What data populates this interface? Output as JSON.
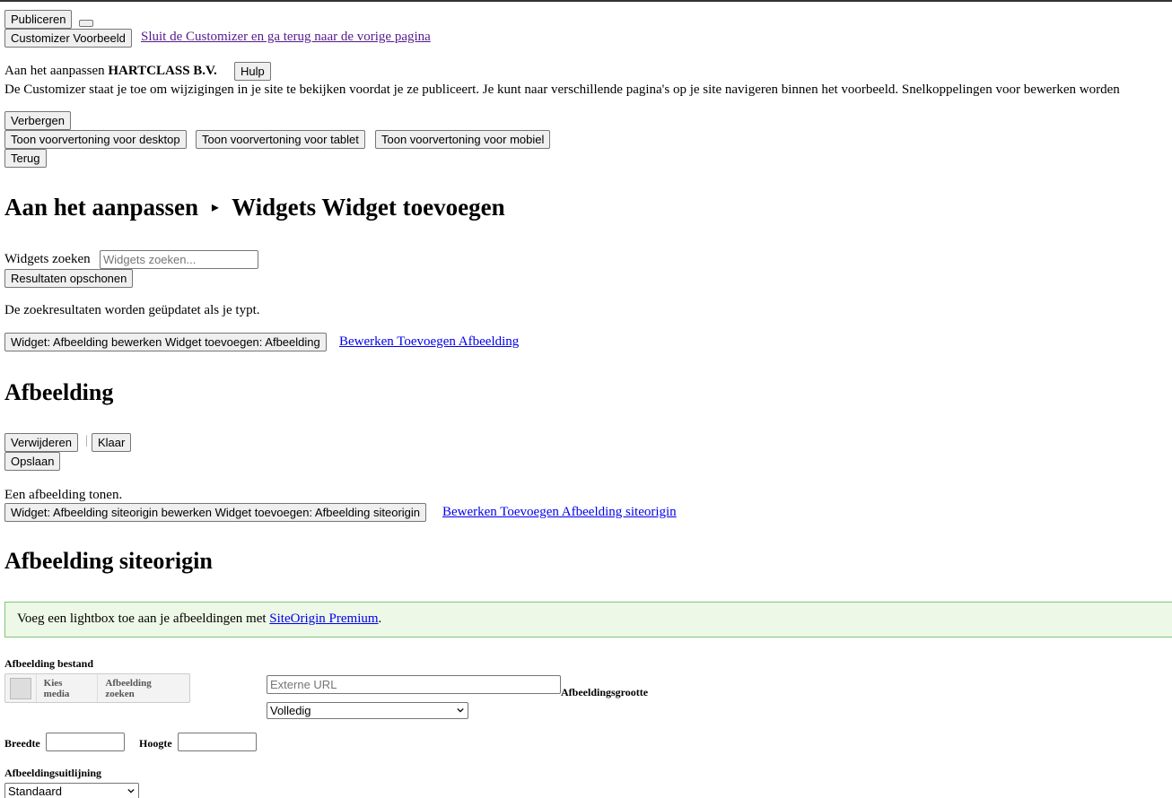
{
  "top": {
    "publish_label": "Publiceren",
    "preview_label": "Customizer Voorbeeld",
    "close_link": "Sluit de Customizer en ga terug naar de vorige pagina"
  },
  "info": {
    "customizing_prefix": "Aan het aanpassen",
    "site_name": "HARTCLASS B.V.",
    "help_label": "Hulp",
    "description": "De Customizer staat je toe om wijzigingen in je site te bekijken voordat je ze publiceert. Je kunt naar verschillende pagina's op je site navigeren binnen het voorbeeld. Snelkoppelingen voor bewerken worden"
  },
  "controls": {
    "hide_label": "Verbergen",
    "desktop_label": "Toon voorvertoning voor desktop",
    "tablet_label": "Toon voorvertoning voor tablet",
    "mobile_label": "Toon voorvertoning voor mobiel",
    "back_label": "Terug"
  },
  "heading": {
    "prefix": "Aan het aanpassen",
    "arrow": "▸",
    "title": "Widgets Widget toevoegen"
  },
  "search": {
    "label": "Widgets zoeken",
    "placeholder": "Widgets zoeken...",
    "clear_label": "Resultaten opschonen",
    "hint": "De zoekresultaten worden geüpdatet als je typt."
  },
  "widget_image": {
    "button_label": "Widget: Afbeelding bewerken Widget toevoegen: Afbeelding",
    "link_label": "Bewerken Toevoegen Afbeelding",
    "title": "Afbeelding",
    "delete_label": "Verwijderen",
    "separator": "|",
    "done_label": "Klaar",
    "save_label": "Opslaan",
    "description": "Een afbeelding tonen."
  },
  "widget_so_image": {
    "button_label": "Widget: Afbeelding siteorigin bewerken Widget toevoegen: Afbeelding siteorigin",
    "link_label": "Bewerken Toevoegen Afbeelding siteorigin",
    "title": "Afbeelding siteorigin",
    "notice_prefix": "Voeg een lightbox toe aan je afbeeldingen met ",
    "notice_link": "SiteOrigin Premium",
    "notice_suffix": "."
  },
  "form": {
    "image_file_label": "Afbeelding bestand",
    "choose_media": "Kies media",
    "search_image": "Afbeelding zoeken",
    "external_url_placeholder": "Externe URL",
    "image_size_label": "Afbeeldingsgrootte",
    "image_size_value": "Volledig",
    "width_label": "Breedte",
    "height_label": "Hoogte",
    "alignment_label": "Afbeeldingsuitlijning",
    "alignment_value": "Standaard"
  }
}
